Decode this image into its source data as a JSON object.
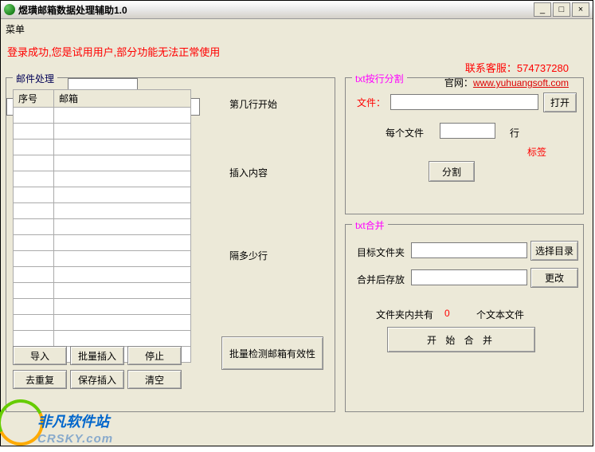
{
  "window": {
    "title": "煜璜邮箱数据处理辅助1.0",
    "minimize": "_",
    "maximize": "□",
    "close": "×"
  },
  "menu": {
    "label": "菜单"
  },
  "alert": "登录成功,您是试用用户,部分功能无法正常使用",
  "contact": {
    "qq_label": "联系客服：",
    "qq": "574737280",
    "site_label": "官网：",
    "url": "www.yuhuangsoft.com"
  },
  "mail": {
    "legend": "邮件处理",
    "col_index": "序号",
    "col_mail": "邮箱",
    "start_label": "第几行开始",
    "start_value": "",
    "insert_label": "插入内容",
    "insert_value": "",
    "gap_label": "隔多少行",
    "gap_value": "",
    "import": "导入",
    "batch_insert": "批量插入",
    "stop": "停止",
    "dedup": "去重复",
    "save_insert": "保存插入",
    "clear": "清空",
    "batch_check": "批量检测邮箱有效性"
  },
  "split": {
    "legend": "txt按行分割",
    "file_label": "文件：",
    "file_value": "",
    "open": "打开",
    "per_label": "每个文件",
    "per_value": "",
    "rows_label": "行",
    "tag_label": "标签",
    "split": "分割"
  },
  "merge": {
    "legend": "txt合并",
    "target_label": "目标文件夹",
    "target_value": "",
    "select_dir": "选择目录",
    "saveto_label": "合并后存放",
    "saveto_value": "",
    "change": "更改",
    "count_pre": "文件夹内共有",
    "count_n": "0",
    "count_suf": "个文本文件",
    "start_merge": "开 始 合 并"
  },
  "watermark": {
    "text1": "非凡软件站",
    "text2": "CRSKY.com"
  }
}
